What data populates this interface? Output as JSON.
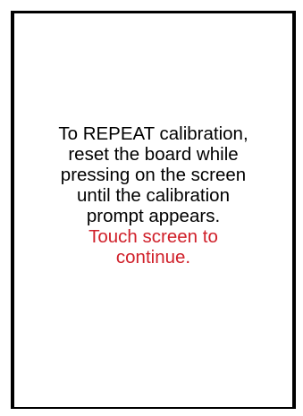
{
  "screen": {
    "instruction_lines": [
      "To REPEAT calibration,",
      "reset the board while",
      "pressing on the screen",
      "until the calibration",
      "prompt appears."
    ],
    "continue_lines": [
      "Touch screen to",
      "continue."
    ]
  },
  "colors": {
    "text": "#000000",
    "prompt": "#d0202a",
    "border": "#000000",
    "background": "#ffffff"
  }
}
